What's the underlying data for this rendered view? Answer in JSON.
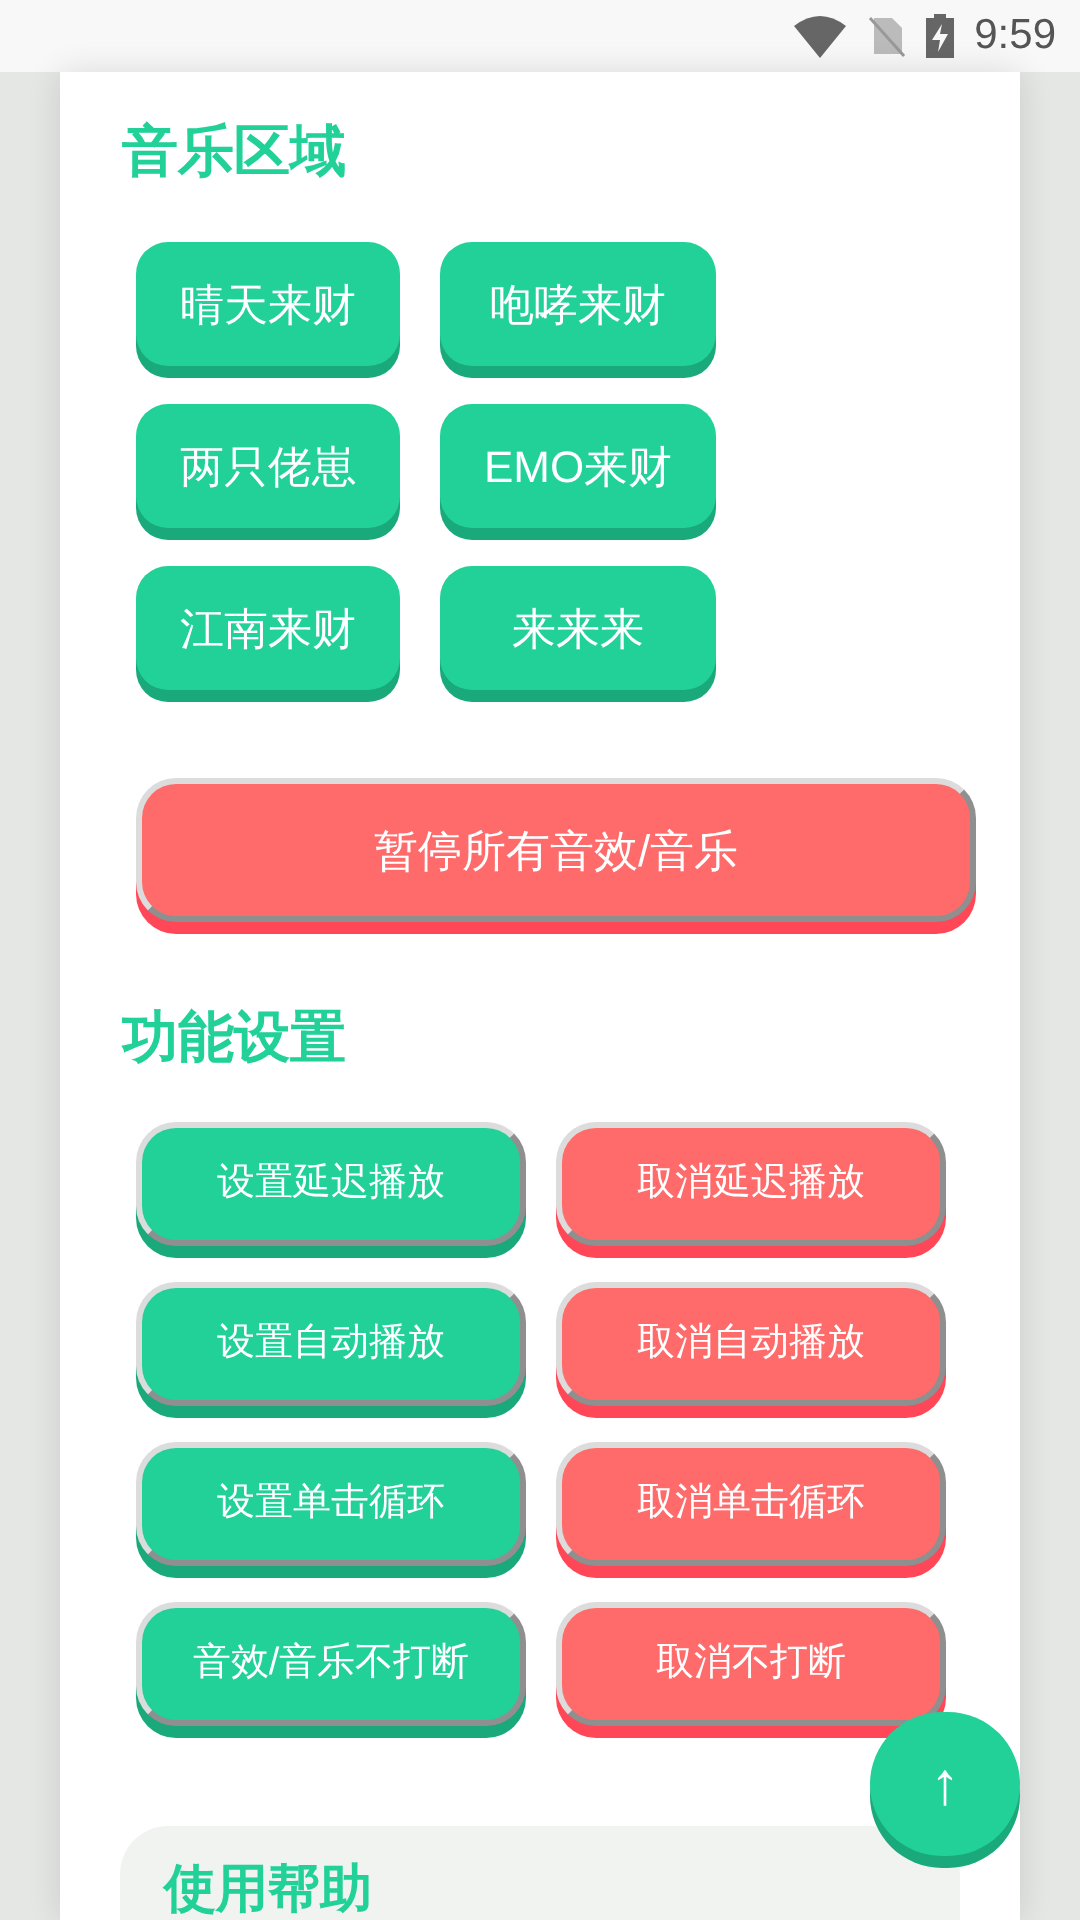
{
  "status_bar": {
    "time": "9:59"
  },
  "music_section": {
    "title": "音乐区域",
    "buttons": [
      "晴天来财",
      "咆哮来财",
      "两只佬崽",
      "EMO来财",
      "江南来财",
      "来来来"
    ]
  },
  "stop_all_button": "暂停所有音效/音乐",
  "settings_section": {
    "title": "功能设置",
    "buttons": [
      {
        "label": "设置延迟播放",
        "kind": "set"
      },
      {
        "label": "取消延迟播放",
        "kind": "cancel"
      },
      {
        "label": "设置自动播放",
        "kind": "set"
      },
      {
        "label": "取消自动播放",
        "kind": "cancel"
      },
      {
        "label": "设置单击循环",
        "kind": "set"
      },
      {
        "label": "取消单击循环",
        "kind": "cancel"
      },
      {
        "label": "音效/音乐不打断",
        "kind": "set"
      },
      {
        "label": "取消不打断",
        "kind": "cancel"
      }
    ]
  },
  "scroll_top_button": "↑",
  "help_section": {
    "title": "使用帮助"
  }
}
